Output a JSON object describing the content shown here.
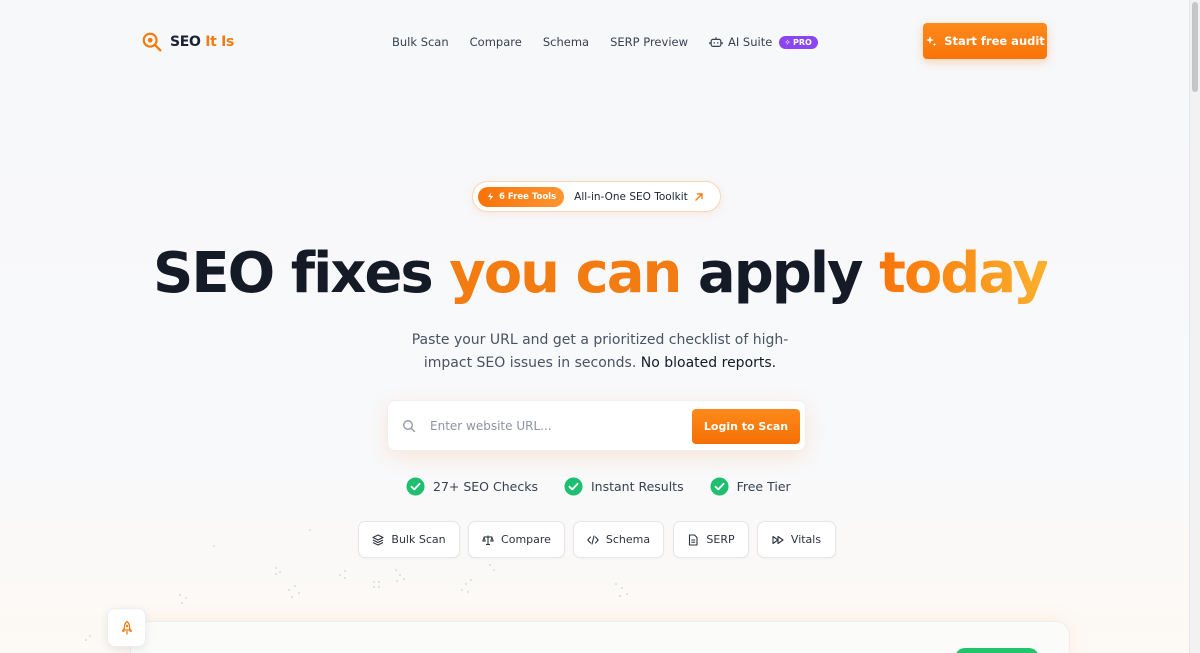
{
  "brand": {
    "name_primary": "SEO",
    "name_accent": "It Is",
    "icon": "magnifier-icon",
    "accent_color": "#f27c11"
  },
  "nav": {
    "items": [
      {
        "label": "Bulk Scan"
      },
      {
        "label": "Compare"
      },
      {
        "label": "Schema"
      },
      {
        "label": "SERP Preview"
      }
    ],
    "ai_suite": {
      "label": "AI Suite",
      "icon": "robot-icon",
      "badge": "PRO",
      "badge_color": "#8b46f2"
    }
  },
  "header_cta": {
    "label": "Start free audit",
    "icon": "sparkles-icon"
  },
  "hero": {
    "pill_badge": "6 Free Tools",
    "pill_badge_icon": "bolt-icon",
    "pill_text": "All-in-One SEO Toolkit",
    "pill_arrow_icon": "arrow-up-right-icon",
    "headline_part1": "SEO fixes ",
    "headline_part2": "you can",
    "headline_part3": " apply ",
    "headline_part4": "today",
    "subtitle_line1": "Paste your URL and get a prioritized checklist of high-",
    "subtitle_line2": "impact SEO issues in seconds.",
    "subtitle_strong": "No bloated reports."
  },
  "search": {
    "placeholder": "Enter website URL...",
    "value": "",
    "button_label": "Login to Scan",
    "icon": "search-icon"
  },
  "features": [
    {
      "label": "27+ SEO Checks",
      "icon": "check-circle-icon"
    },
    {
      "label": "Instant Results",
      "icon": "check-circle-icon"
    },
    {
      "label": "Free Tier",
      "icon": "check-circle-icon"
    }
  ],
  "tools": [
    {
      "label": "Bulk Scan",
      "icon": "layers-icon"
    },
    {
      "label": "Compare",
      "icon": "scale-icon"
    },
    {
      "label": "Schema",
      "icon": "code-icon"
    },
    {
      "label": "SERP",
      "icon": "document-icon"
    },
    {
      "label": "Vitals",
      "icon": "fast-forward-icon"
    }
  ],
  "floating_button": {
    "icon": "rocket-icon"
  },
  "colors": {
    "orange": "#f97308",
    "green": "#1fbf71",
    "purple": "#8b46f2"
  }
}
